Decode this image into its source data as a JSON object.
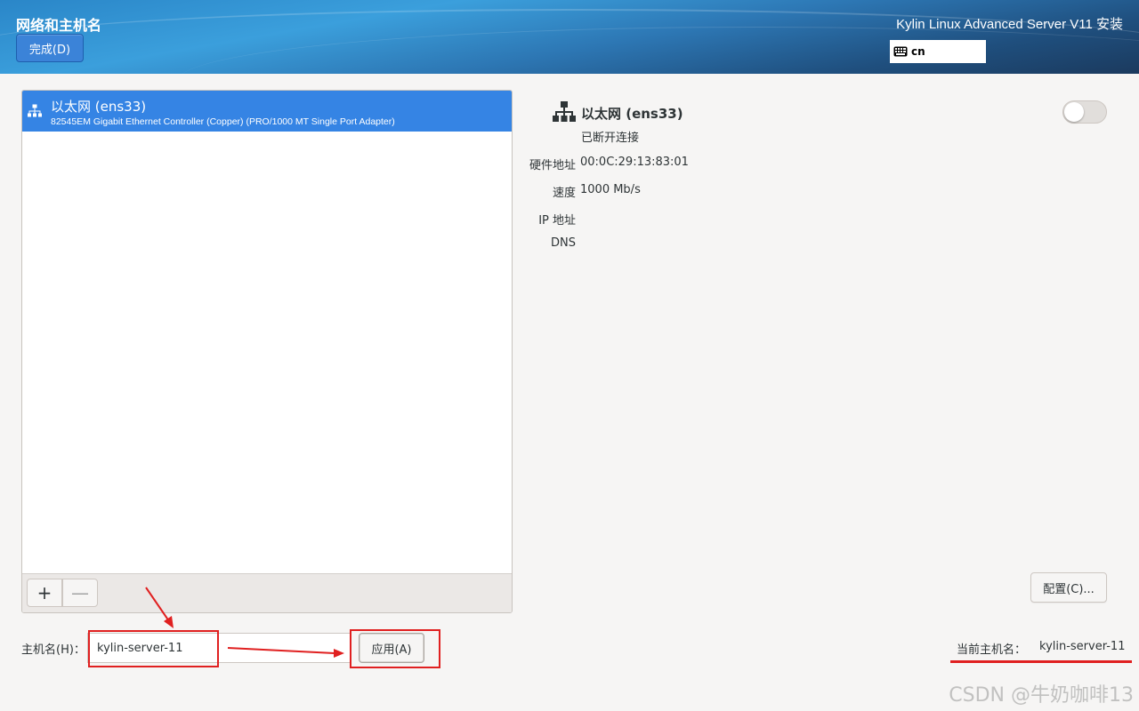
{
  "header": {
    "title": "网络和主机名",
    "done_label": "完成(D)",
    "product": "Kylin Linux Advanced Server V11 安装",
    "keyboard_layout": "cn"
  },
  "devices": {
    "items": [
      {
        "title": "以太网 (ens33)",
        "subtitle": "82545EM Gigabit Ethernet Controller (Copper) (PRO/1000 MT Single Port Adapter)"
      }
    ],
    "add_label": "+",
    "remove_label": "—"
  },
  "detail": {
    "title": "以太网 (ens33)",
    "status": "已断开连接",
    "toggle_on": false,
    "hw_label": "硬件地址",
    "hw_value": "00:0C:29:13:83:01",
    "speed_label": "速度",
    "speed_value": "1000 Mb/s",
    "ip_label": "IP 地址",
    "dns_label": "DNS",
    "config_label": "配置(C)..."
  },
  "hostname": {
    "label": "主机名(H)：",
    "value": "kylin-server-11",
    "apply_label": "应用(A)",
    "current_label": "当前主机名：",
    "current_value": "kylin-server-11"
  },
  "watermark": "CSDN @牛奶咖啡13",
  "colors": {
    "accent": "#3584e4",
    "annotation": "#e02020"
  }
}
